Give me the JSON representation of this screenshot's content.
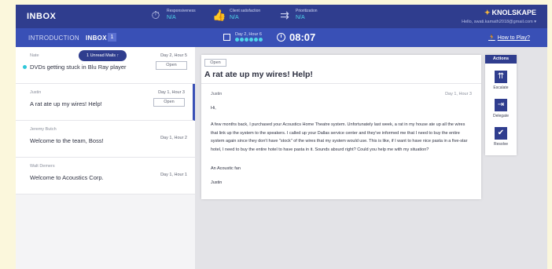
{
  "topbar": {
    "title": "INBOX",
    "metrics": [
      {
        "label": "Responsiveness",
        "value": "N/A",
        "icon": "stopwatch-icon",
        "glyph": "⏱"
      },
      {
        "label": "Client satisfaction",
        "value": "N/A",
        "icon": "thumbs-up-icon",
        "glyph": "👍"
      },
      {
        "label": "Prioritization",
        "value": "N/A",
        "icon": "priority-arrows-icon",
        "glyph": "⇉"
      }
    ],
    "brand": "KNOLSKAPE",
    "hello": "Hello, swati.kamath2018@gmail.com ▾"
  },
  "navbar": {
    "tabs": [
      "INTRODUCTION",
      "INBOX"
    ],
    "inbox_count": "1",
    "day": "Day 2, Hour 6",
    "time": "08:07",
    "how_to_play": "How to Play?"
  },
  "unread_pill": "1 Unread Mails ↑",
  "emails": [
    {
      "sender": "Nate",
      "subject": "DVDs getting stuck in Blu Ray player",
      "when": "Day 2, Hour 5",
      "button": "Open"
    },
    {
      "sender": "Justin",
      "subject": "A rat ate up my wires! Help!",
      "when": "Day 1, Hour 3",
      "button": "Open"
    },
    {
      "sender": "Jeremy Butch",
      "subject": "Welcome to the team, Boss!",
      "when": "Day 1, Hour 2"
    },
    {
      "sender": "Walt Demers",
      "subject": "Welcome to Acoustics Corp.",
      "when": "Day 1, Hour 1"
    }
  ],
  "reader": {
    "status": "Open",
    "heading": "A rat ate up my wires! Help!",
    "from": "Justin",
    "date": "Day 1, Hour 3",
    "greeting": "Hi,",
    "body": "A few months back, I purchased your Acoustics Home Theatre system. Unfortunately last week, a rat in my house ate up all the wires that link up the system to the speakers. I called up your Dallas service center and they've informed me that I need to buy the entire system again since they don't have \"stock\" of the wires that my system would use. This is like, if I want to have nice pasta in a five-star hotel, I need to buy the entire hotel to have pasta in it. Sounds absurd right? Could you help me with my situation?",
    "sign1": "An Acoustic fan",
    "sign2": "Justin"
  },
  "actions": {
    "title": "Actions",
    "items": [
      {
        "label": "Escalate",
        "icon": "escalate-icon",
        "glyph": "⇈"
      },
      {
        "label": "Delegate",
        "icon": "delegate-icon",
        "glyph": "⇥"
      },
      {
        "label": "Resolve",
        "icon": "resolve-icon",
        "glyph": "✔"
      }
    ]
  },
  "colors": {
    "primary": "#2f3d8e",
    "nav": "#3950b6",
    "accent": "#4fd4e8",
    "background": "#fbf7dc"
  }
}
